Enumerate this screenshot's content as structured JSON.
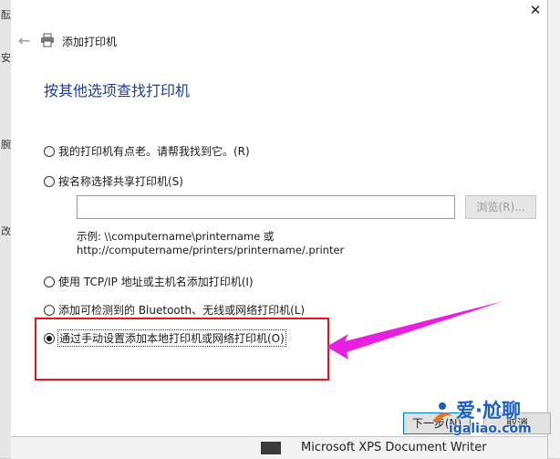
{
  "background": {
    "left_glyphs": [
      "酝",
      "安",
      "腕",
      "改"
    ],
    "bottom_item": "Microsoft XPS Document Writer"
  },
  "dialog": {
    "title": "添加打印机",
    "heading": "按其他选项查找打印机",
    "close_symbol": "✕",
    "back_symbol": "←",
    "options": [
      {
        "label": "我的打印机有点老。请帮我找到它。(R)",
        "checked": false
      },
      {
        "label": "按名称选择共享打印机(S)",
        "checked": false
      },
      {
        "label": "使用 TCP/IP 地址或主机名添加打印机(I)",
        "checked": false
      },
      {
        "label": "添加可检测到的 Bluetooth、无线或网络打印机(L)",
        "checked": false
      },
      {
        "label": "通过手动设置添加本地打印机或网络打印机(O)",
        "checked": true
      }
    ],
    "share": {
      "input_value": "",
      "browse_label": "浏览(R)...",
      "example_line1": "示例: \\\\computername\\printername 或",
      "example_line2": "http://computername/printers/printername/.printer"
    },
    "buttons": {
      "next": "下一步(N)",
      "cancel": "取消"
    }
  },
  "annotation": {
    "box_color": "#e4141c",
    "arrow_color": "#e81ee0"
  },
  "watermark": {
    "title": "爱·尬聊",
    "url": "igaliao.com"
  }
}
